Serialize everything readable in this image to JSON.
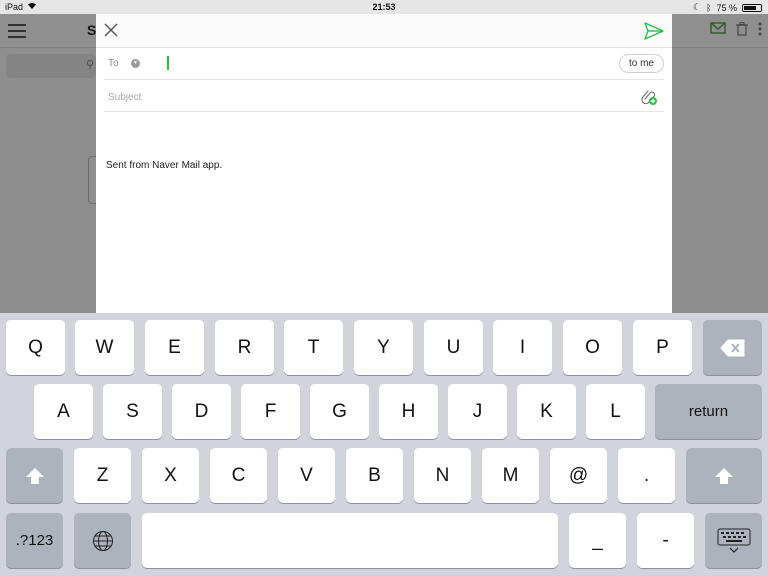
{
  "status_bar": {
    "device": "iPad",
    "time": "21:53",
    "battery": "75 %",
    "battery_level": 0.75
  },
  "background_app": {
    "title": "S"
  },
  "compose": {
    "to_label": "To",
    "to_value": "",
    "to_me_label": "to me",
    "subject_placeholder": "Subject",
    "subject_value": "",
    "signature": "Sent from Naver Mail app."
  },
  "keyboard": {
    "row1": [
      "Q",
      "W",
      "E",
      "R",
      "T",
      "Y",
      "U",
      "I",
      "O",
      "P"
    ],
    "row2": [
      "A",
      "S",
      "D",
      "F",
      "G",
      "H",
      "J",
      "K",
      "L"
    ],
    "row3": [
      "Z",
      "X",
      "C",
      "V",
      "B",
      "N",
      "M",
      "@",
      "."
    ],
    "return_label": "return",
    "numbers_label": ".?123",
    "underscore_label": "_",
    "dash_label": "-"
  },
  "colors": {
    "accent_green": "#27c24c",
    "keyboard_bg": "#d1d5db",
    "key_dark": "#acb3bc"
  }
}
